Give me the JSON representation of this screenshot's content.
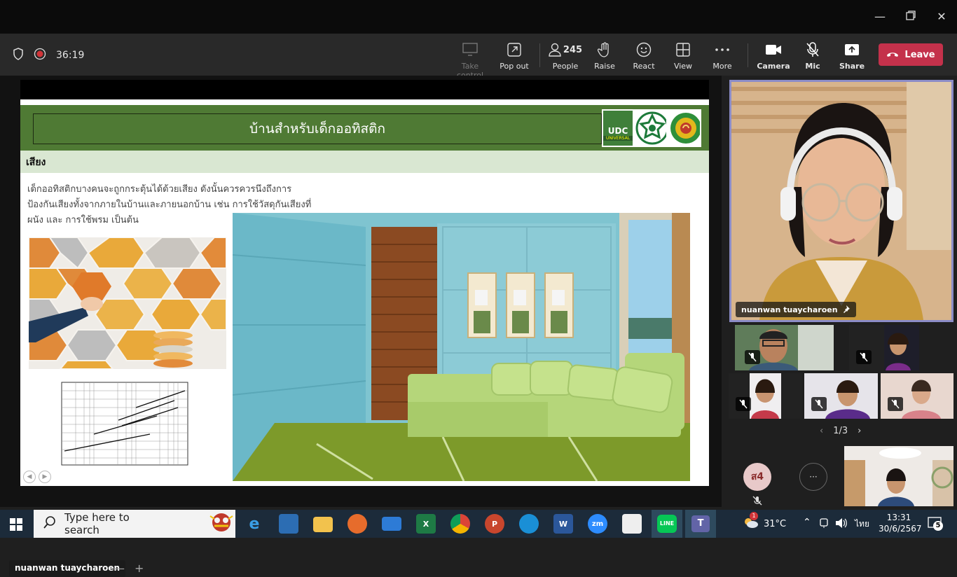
{
  "meeting": {
    "timer": "36:19",
    "toolbar": {
      "take_control": "Take control",
      "pop_out": "Pop out",
      "people_count": "245",
      "people": "People",
      "raise": "Raise",
      "react": "React",
      "view": "View",
      "more": "More",
      "camera": "Camera",
      "mic": "Mic",
      "share": "Share",
      "leave": "Leave"
    },
    "presenter_label": "nuanwan tuaycharoen",
    "pinned_participant": "nuanwan tuaycharoen",
    "pager": "1/3",
    "avatar_initials": "ส4",
    "more_dots": "···"
  },
  "slide": {
    "title": "บ้านสำหรับเด็กออทิสติก",
    "logo_text": "UDC",
    "logo_subtext": "UNIVERSAL",
    "section": "เสียง",
    "body_lines": [
      "เด็กออทิสติกบางคนจะถูกกระตุ้นได้ด้วยเสียง ดังนั้นควรควรนึงถึงการ",
      "ป้องกันเสียงทั้งจากภายในบ้านและภายนอกบ้าน เช่น การใช้วัสดุกันเสียงที่",
      "ผนัง และ การใช้พรม เป็นต้น"
    ]
  },
  "taskbar": {
    "search_placeholder": "Type here to search",
    "weather": "31°C",
    "language": "ไทย",
    "time": "13:31",
    "date": "30/6/2567",
    "notif_count": "5",
    "weather_badge": "1"
  }
}
